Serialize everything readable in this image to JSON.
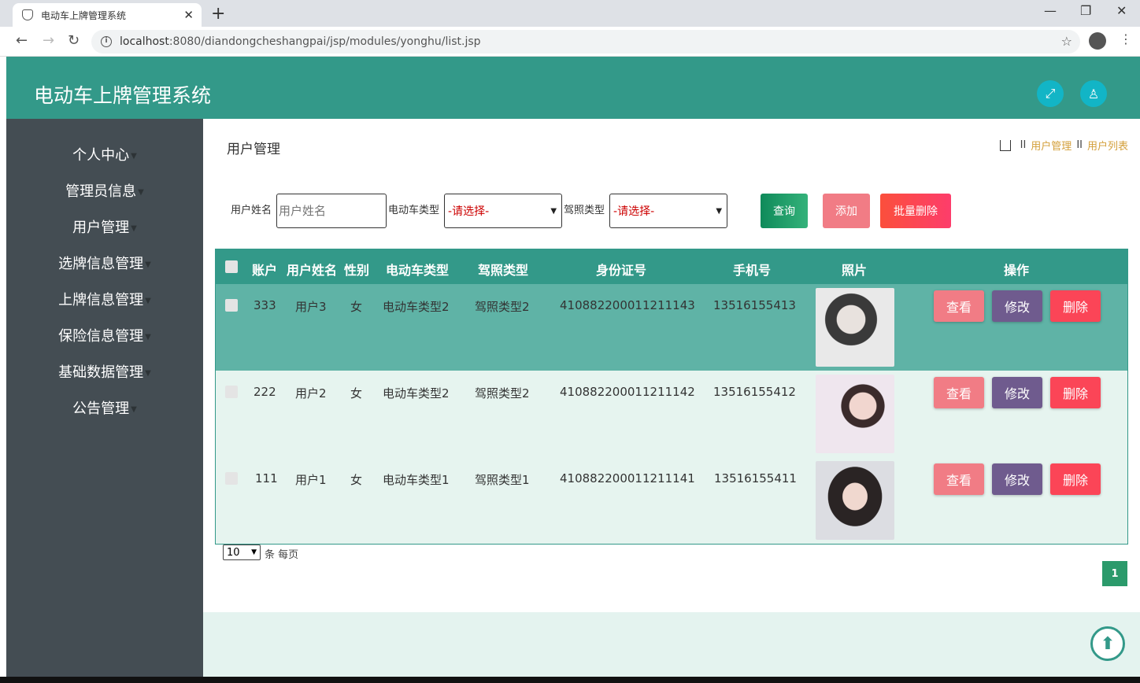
{
  "browser": {
    "tab_title": "电动车上牌管理系统",
    "url_host": "localhost",
    "url_rest": ":8080/diandongcheshangpai/jsp/modules/yonghu/list.jsp"
  },
  "app": {
    "title": "电动车上牌管理系统"
  },
  "sidebar": {
    "items": [
      {
        "label": "个人中心"
      },
      {
        "label": "管理员信息"
      },
      {
        "label": "用户管理"
      },
      {
        "label": "选牌信息管理"
      },
      {
        "label": "上牌信息管理"
      },
      {
        "label": "保险信息管理"
      },
      {
        "label": "基础数据管理"
      },
      {
        "label": "公告管理"
      }
    ]
  },
  "page": {
    "title": "用户管理",
    "breadcrumb": [
      "用户管理",
      "用户列表"
    ],
    "breadcrumb_sep": "II"
  },
  "search": {
    "name_label": "用户姓名",
    "name_placeholder": "用户姓名",
    "vehicle_label": "电动车类型",
    "vehicle_value": "-请选择-",
    "license_label": "驾照类型",
    "license_value": "-请选择-",
    "query_btn": "查询",
    "add_btn": "添加",
    "batch_delete_btn": "批量删除"
  },
  "table": {
    "headers": [
      "账户",
      "用户姓名",
      "性别",
      "电动车类型",
      "驾照类型",
      "身份证号",
      "手机号",
      "照片",
      "操作"
    ],
    "rows": [
      {
        "account": "333",
        "name": "用户3",
        "gender": "女",
        "vehicle": "电动车类型2",
        "license": "驾照类型2",
        "id_no": "410882200011211143",
        "phone": "13516155413"
      },
      {
        "account": "222",
        "name": "用户2",
        "gender": "女",
        "vehicle": "电动车类型2",
        "license": "驾照类型2",
        "id_no": "410882200011211142",
        "phone": "13516155412"
      },
      {
        "account": "111",
        "name": "用户1",
        "gender": "女",
        "vehicle": "电动车类型1",
        "license": "驾照类型1",
        "id_no": "410882200011211141",
        "phone": "13516155411"
      }
    ],
    "view_btn": "查看",
    "edit_btn": "修改",
    "delete_btn": "删除"
  },
  "pager": {
    "page_size": "10",
    "per_page_text": "条 每页",
    "current_page": "1"
  },
  "colors": {
    "primary": "#339989",
    "sidebar_bg": "#444d53",
    "row_highlight": "#5fb3a6",
    "row_alt": "#e6f4ef",
    "view_btn": "#f17c85",
    "edit_btn": "#6f5b8e",
    "delete_btn": "#fb4557"
  }
}
